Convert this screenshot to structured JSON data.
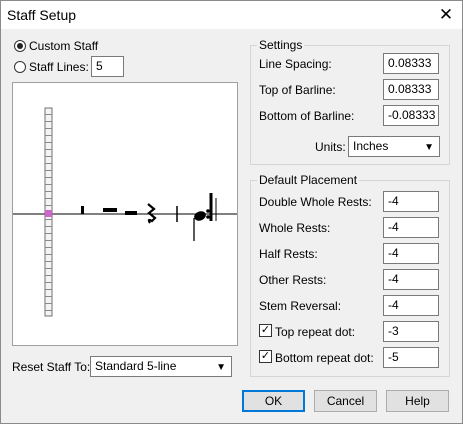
{
  "window": {
    "title": "Staff Setup",
    "close_glyph": "✕"
  },
  "staff_type": {
    "custom_label": "Custom Staff",
    "custom_selected": true,
    "lines_label": "Staff Lines:",
    "lines_selected": false,
    "lines_value": "5"
  },
  "settings": {
    "title": "Settings",
    "line_spacing_label": "Line Spacing:",
    "line_spacing_value": "0.08333",
    "top_barline_label": "Top of Barline:",
    "top_barline_value": "0.08333",
    "bottom_barline_label": "Bottom of Barline:",
    "bottom_barline_value": "-0.08333",
    "units_label": "Units:",
    "units_value": "Inches"
  },
  "placement": {
    "title": "Default Placement",
    "rows": [
      {
        "label": "Double Whole Rests:",
        "value": "-4"
      },
      {
        "label": "Whole Rests:",
        "value": "-4"
      },
      {
        "label": "Half Rests:",
        "value": "-4"
      },
      {
        "label": "Other Rests:",
        "value": "-4"
      },
      {
        "label": "Stem Reversal:",
        "value": "-4"
      }
    ],
    "top_repeat_label": "Top repeat dot:",
    "top_repeat_checked": true,
    "top_repeat_value": "-3",
    "bottom_repeat_label": "Bottom repeat dot:",
    "bottom_repeat_checked": true,
    "bottom_repeat_value": "-5"
  },
  "reset": {
    "label": "Reset Staff To:",
    "value": "Standard 5-line"
  },
  "buttons": {
    "ok": "OK",
    "cancel": "Cancel",
    "help": "Help"
  },
  "icons": {
    "chevron": "chevron-down-icon",
    "check": "checkmark-icon",
    "close": "close-icon"
  },
  "colors": {
    "accent": "#0078d7",
    "highlight": "#cc66cc"
  }
}
